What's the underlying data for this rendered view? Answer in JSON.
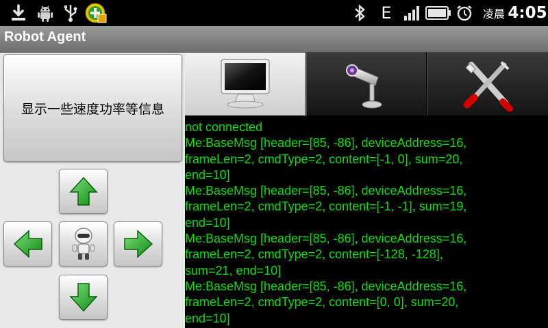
{
  "status_bar": {
    "icons": {
      "download": "download-icon",
      "android": "android-debug-icon",
      "usb": "usb-icon",
      "app": "app-notification-icon",
      "bluetooth": "bluetooth-icon",
      "signal": "signal-strength-icon",
      "battery": "battery-icon",
      "alarm": "alarm-clock-icon"
    },
    "network_type": "E",
    "am_pm": "凌晨",
    "time": "4:05"
  },
  "app": {
    "title": "Robot Agent"
  },
  "left_panel": {
    "info_button_label": "显示一些速度功率等信息",
    "controls": {
      "up": "arrow-up-icon",
      "down": "arrow-down-icon",
      "left": "arrow-left-icon",
      "right": "arrow-right-icon",
      "center": "robot-icon"
    }
  },
  "tabs": [
    {
      "id": "monitor",
      "icon": "monitor-icon",
      "selected": true
    },
    {
      "id": "camera",
      "icon": "webcam-icon",
      "selected": false
    },
    {
      "id": "settings",
      "icon": "tools-icon",
      "selected": false
    }
  ],
  "log": {
    "status": "not connected",
    "messages": [
      "Me:BaseMsg [header=[85, -86], deviceAddress=16,",
      "frameLen=2, cmdType=2, content=[-1, 0], sum=20,",
      "end=10]",
      "Me:BaseMsg [header=[85, -86], deviceAddress=16,",
      "frameLen=2, cmdType=2, content=[-1, -1], sum=19,",
      "end=10]",
      "Me:BaseMsg [header=[85, -86], deviceAddress=16,",
      "frameLen=2, cmdType=2, content=[-128, -128],",
      "sum=21, end=10]",
      "Me:BaseMsg [header=[85, -86], deviceAddress=16,",
      "frameLen=2, cmdType=2, content=[0, 0], sum=20,",
      "end=10]"
    ]
  },
  "colors": {
    "log_text": "#00e000",
    "arrow_green": "#22b422",
    "background": "#000000"
  }
}
